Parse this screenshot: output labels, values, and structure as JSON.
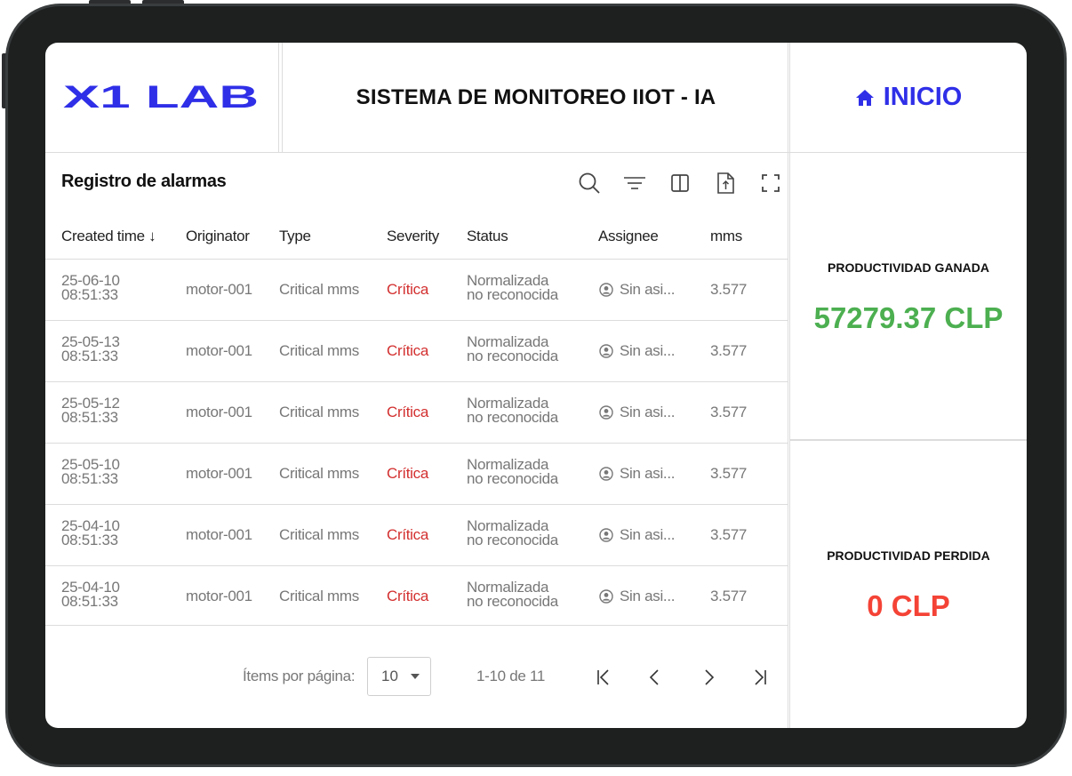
{
  "header": {
    "logo": "X1 LAB",
    "title": "SISTEMA DE MONITOREO IIOT - IA",
    "home_label": "INICIO"
  },
  "alarms": {
    "title": "Registro de alarmas",
    "toolbar_icons": [
      "search-icon",
      "filter-icon",
      "columns-icon",
      "export-icon",
      "fullscreen-icon"
    ],
    "columns": [
      "Created time",
      "Originator",
      "Type",
      "Severity",
      "Status",
      "Assignee",
      "mms"
    ],
    "sort_indicator": "↓",
    "rows": [
      {
        "date": "25-06-10",
        "time": "08:51:33",
        "originator": "motor-001",
        "type": "Critical mms",
        "severity": "Crítica",
        "status_1": "Normalizada",
        "status_2": "no reconocida",
        "assignee": "Sin asi...",
        "mms": "3.577"
      },
      {
        "date": "25-05-13",
        "time": "08:51:33",
        "originator": "motor-001",
        "type": "Critical mms",
        "severity": "Crítica",
        "status_1": "Normalizada",
        "status_2": "no reconocida",
        "assignee": "Sin asi...",
        "mms": "3.577"
      },
      {
        "date": "25-05-12",
        "time": "08:51:33",
        "originator": "motor-001",
        "type": "Critical mms",
        "severity": "Crítica",
        "status_1": "Normalizada",
        "status_2": "no reconocida",
        "assignee": "Sin asi...",
        "mms": "3.577"
      },
      {
        "date": "25-05-10",
        "time": "08:51:33",
        "originator": "motor-001",
        "type": "Critical mms",
        "severity": "Crítica",
        "status_1": "Normalizada",
        "status_2": "no reconocida",
        "assignee": "Sin asi...",
        "mms": "3.577"
      },
      {
        "date": "25-04-10",
        "time": "08:51:33",
        "originator": "motor-001",
        "type": "Critical mms",
        "severity": "Crítica",
        "status_1": "Normalizada",
        "status_2": "no reconocida",
        "assignee": "Sin asi...",
        "mms": "3.577"
      },
      {
        "date": "25-04-10",
        "time": "08:51:33",
        "originator": "motor-001",
        "type": "Critical mms",
        "severity": "Crítica",
        "status_1": "Normalizada",
        "status_2": "no reconocida",
        "assignee": "Sin asi...",
        "mms": "3.577"
      }
    ]
  },
  "pagination": {
    "items_label": "Ítems por página:",
    "page_size": "10",
    "range": "1-10 de 11"
  },
  "kpis": {
    "gained_label": "PRODUCTIVIDAD GANADA",
    "gained_value": "57279.37 CLP",
    "lost_label": "PRODUCTIVIDAD PERDIDA",
    "lost_value": "0 CLP"
  },
  "colors": {
    "brand": "#2f2fe8",
    "gained": "#4caf50",
    "lost": "#f44336",
    "severity_critical": "#d32f2f",
    "bezel": "#1e2020"
  }
}
